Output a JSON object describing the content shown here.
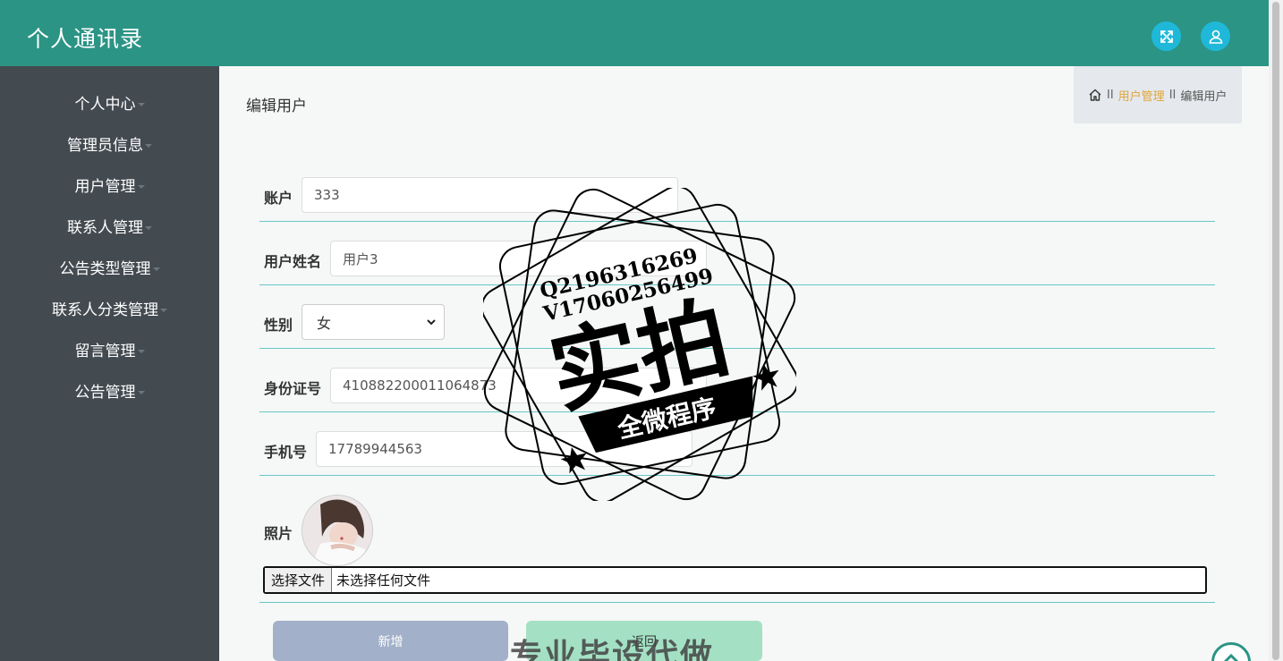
{
  "header": {
    "app_title": "个人通讯录"
  },
  "sidebar": {
    "items": [
      {
        "label": "个人中心"
      },
      {
        "label": "管理员信息"
      },
      {
        "label": "用户管理"
      },
      {
        "label": "联系人管理"
      },
      {
        "label": "公告类型管理"
      },
      {
        "label": "联系人分类管理"
      },
      {
        "label": "留言管理"
      },
      {
        "label": "公告管理"
      }
    ]
  },
  "page": {
    "heading": "编辑用户"
  },
  "breadcrumb": {
    "sep1": "II",
    "section": "用户管理",
    "sep2": "II",
    "current": "编辑用户"
  },
  "form": {
    "account": {
      "label": "账户",
      "value": "333"
    },
    "name": {
      "label": "用户姓名",
      "value": "用户3"
    },
    "gender": {
      "label": "性别",
      "value": "女"
    },
    "id_card": {
      "label": "身份证号",
      "value": "410882200011064873"
    },
    "phone": {
      "label": "手机号",
      "value": "17789944563"
    },
    "photo": {
      "label": "照片"
    },
    "file": {
      "button": "选择文件",
      "status": "未选择任何文件"
    }
  },
  "buttons": {
    "add": "新增",
    "back": "返回"
  },
  "watermark": {
    "line1": "Q2196316269",
    "line2": "V17060256499",
    "main": "实拍",
    "ribbon": "全微程序",
    "bottom": "专业毕设代做"
  },
  "colors": {
    "header": "#2b9485",
    "sidebar": "#434a50",
    "accent_icon": "#1fb8d8",
    "breadcrumb_link": "#e0a53a",
    "row_line": "#67c7c6"
  }
}
